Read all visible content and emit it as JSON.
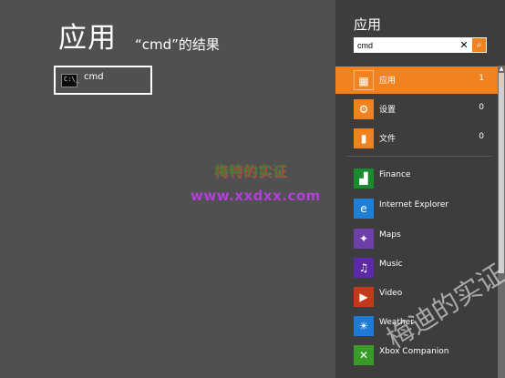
{
  "main": {
    "title": "应用",
    "results_for": "“cmd”的结果",
    "results": [
      {
        "label": "cmd",
        "icon": "command-prompt-icon"
      }
    ]
  },
  "watermarks": {
    "cn": "梅特的实证",
    "url": "www.xxdxx.com",
    "corner": "梅迪的实证"
  },
  "charm": {
    "title": "应用",
    "search_value": "cmd",
    "clear_glyph": "✕",
    "go_glyph": "⌕",
    "scopes": [
      {
        "label": "应用",
        "count": "1",
        "icon": "apps-keyboard-icon",
        "glyph": "▦",
        "active": true
      },
      {
        "label": "设置",
        "count": "0",
        "icon": "settings-gear-icon",
        "glyph": "⚙",
        "active": false
      },
      {
        "label": "文件",
        "count": "0",
        "icon": "document-icon",
        "glyph": "▮",
        "active": false
      }
    ],
    "apps": [
      {
        "label": "Finance",
        "icon": "finance-chart-icon",
        "glyph": "▟",
        "color": "#1b8a2e"
      },
      {
        "label": "Internet Explorer",
        "icon": "internet-explorer-icon",
        "glyph": "e",
        "color": "#1e7fd6"
      },
      {
        "label": "Maps",
        "icon": "maps-icon",
        "glyph": "✦",
        "color": "#6f3fa8"
      },
      {
        "label": "Music",
        "icon": "music-headphones-icon",
        "glyph": "♫",
        "color": "#5c2aa8"
      },
      {
        "label": "Video",
        "icon": "video-icon",
        "glyph": "▶",
        "color": "#c33a1b"
      },
      {
        "label": "Weather",
        "icon": "weather-sun-icon",
        "glyph": "☀",
        "color": "#1f7ad6"
      },
      {
        "label": "Xbox Companion",
        "icon": "xbox-icon",
        "glyph": "✕",
        "color": "#3a9a2a"
      }
    ]
  }
}
